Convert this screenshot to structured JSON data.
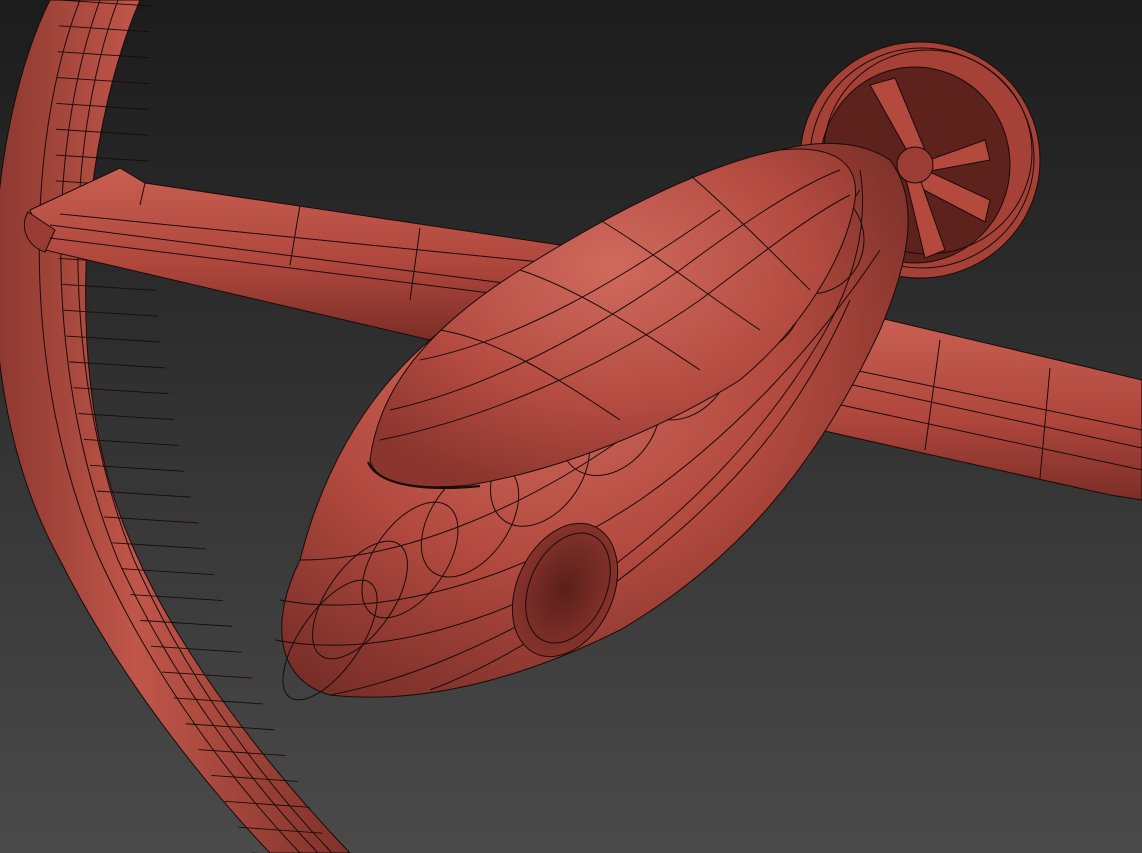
{
  "viewport": {
    "background_top": "#1c1c1c",
    "background_bottom": "#4a4a4a"
  },
  "model": {
    "material_color": "#b0473d",
    "material_dark": "#6e2a24",
    "material_light": "#cf6a5d",
    "wire_color": "#1a0b09",
    "parts": [
      "ring-arch",
      "left-wing",
      "right-wing",
      "fuselage",
      "canopy",
      "side-intake",
      "rear-boom",
      "rear-ducted-fan",
      "fan-blades"
    ]
  }
}
